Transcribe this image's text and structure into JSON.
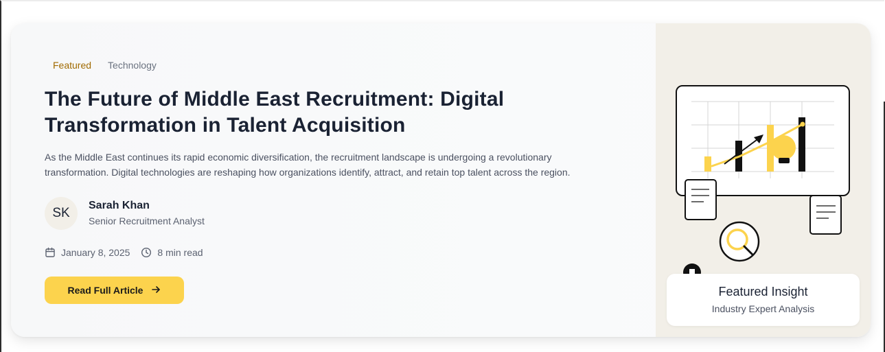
{
  "article": {
    "tags": [
      "Featured",
      "Technology"
    ],
    "title": "The Future of Middle East Recruitment: Digital Transformation in Talent Acquisition",
    "excerpt": "As the Middle East continues its rapid economic diversification, the recruitment landscape is undergoing a revolutionary transformation. Digital technologies are reshaping how organizations identify, attract, and retain top talent across the region.",
    "author": {
      "initials": "SK",
      "name": "Sarah Khan",
      "role": "Senior Recruitment Analyst"
    },
    "date": "January 8, 2025",
    "read_time": "8 min read",
    "cta_label": "Read Full Article",
    "cta_icon": "arrow-right-icon"
  },
  "insight": {
    "title": "Featured Insight",
    "subtitle": "Industry Expert Analysis"
  },
  "colors": {
    "accent_yellow": "#fcd34d",
    "tag_featured": "#a06a00",
    "title_text": "#1a2233",
    "illustration_bg": "#f2efe8"
  }
}
